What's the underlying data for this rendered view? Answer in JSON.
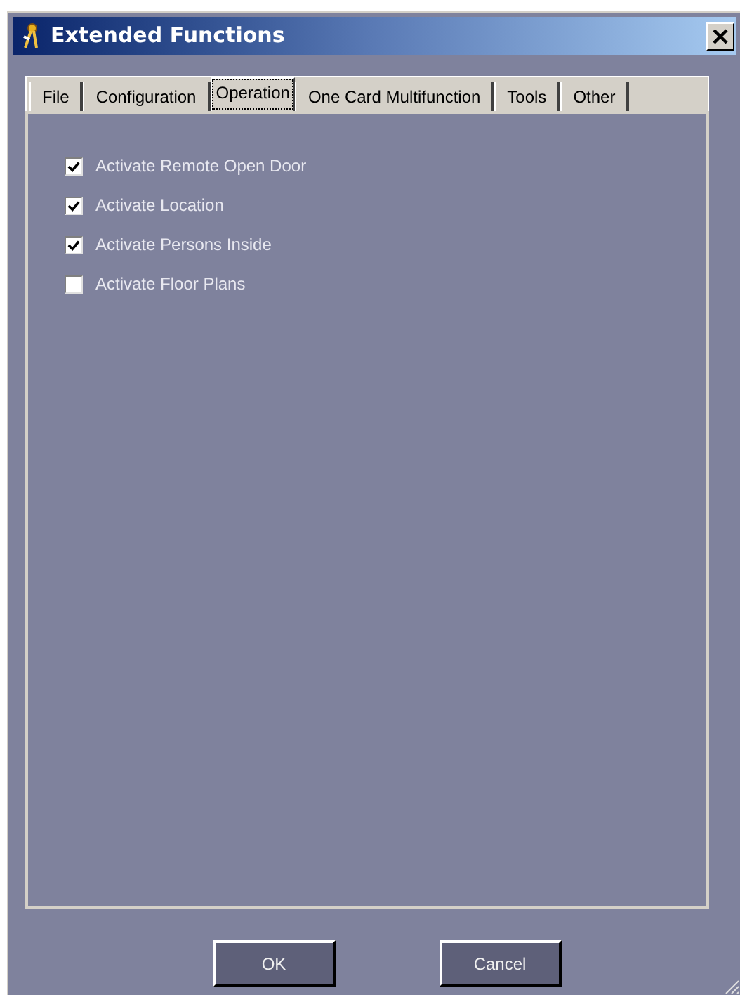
{
  "window": {
    "title": "Extended Functions"
  },
  "tabs": [
    {
      "label": "File",
      "selected": false
    },
    {
      "label": "Configuration",
      "selected": false
    },
    {
      "label": "Operation",
      "selected": true
    },
    {
      "label": "One Card Multifunction",
      "selected": false
    },
    {
      "label": "Tools",
      "selected": false
    },
    {
      "label": "Other",
      "selected": false
    }
  ],
  "options": [
    {
      "label": "Activate Remote Open Door",
      "checked": true
    },
    {
      "label": "Activate Location",
      "checked": true
    },
    {
      "label": "Activate Persons Inside",
      "checked": true
    },
    {
      "label": "Activate Floor Plans",
      "checked": false
    }
  ],
  "buttons": [
    "OK",
    "Cancel"
  ]
}
